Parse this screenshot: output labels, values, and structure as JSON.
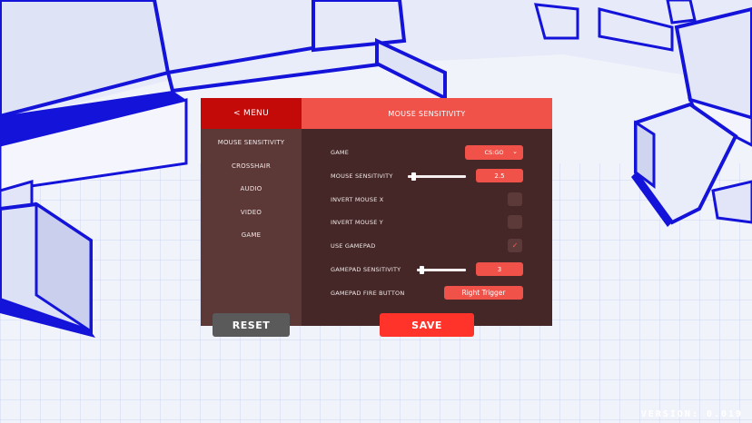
{
  "menu": {
    "back_label": "< MENU",
    "items": [
      "MOUSE SENSITIVITY",
      "CROSSHAIR",
      "AUDIO",
      "VIDEO",
      "GAME"
    ]
  },
  "panel": {
    "title": "MOUSE SENSITIVITY",
    "game": {
      "label": "GAME",
      "value": "CS:GO"
    },
    "mouse_sensitivity": {
      "label": "MOUSE SENSITIVITY",
      "value": "2.5",
      "slider_fraction": 0.09
    },
    "invert_x": {
      "label": "INVERT MOUSE X",
      "checked": false
    },
    "invert_y": {
      "label": "INVERT MOUSE Y",
      "checked": false
    },
    "use_gamepad": {
      "label": "USE GAMEPAD",
      "checked": true,
      "check_glyph": "✓"
    },
    "gamepad_sensitivity": {
      "label": "GAMEPAD SENSITIVITY",
      "value": "3",
      "slider_fraction": 0.1
    },
    "gamepad_fire": {
      "label": "GAMEPAD FIRE BUTTON",
      "value": "Right Trigger"
    }
  },
  "actions": {
    "reset_label": "RESET",
    "save_label": "SAVE"
  },
  "footer": {
    "version": "VERSION: 0.019"
  },
  "colors": {
    "accent": "#f0524a",
    "accent_dark": "#c40a08",
    "panel_bg": "#452727",
    "sidebar_bg": "#5c3837",
    "scene_edge": "#1313d9",
    "scene_fill": "#eef1fb"
  }
}
